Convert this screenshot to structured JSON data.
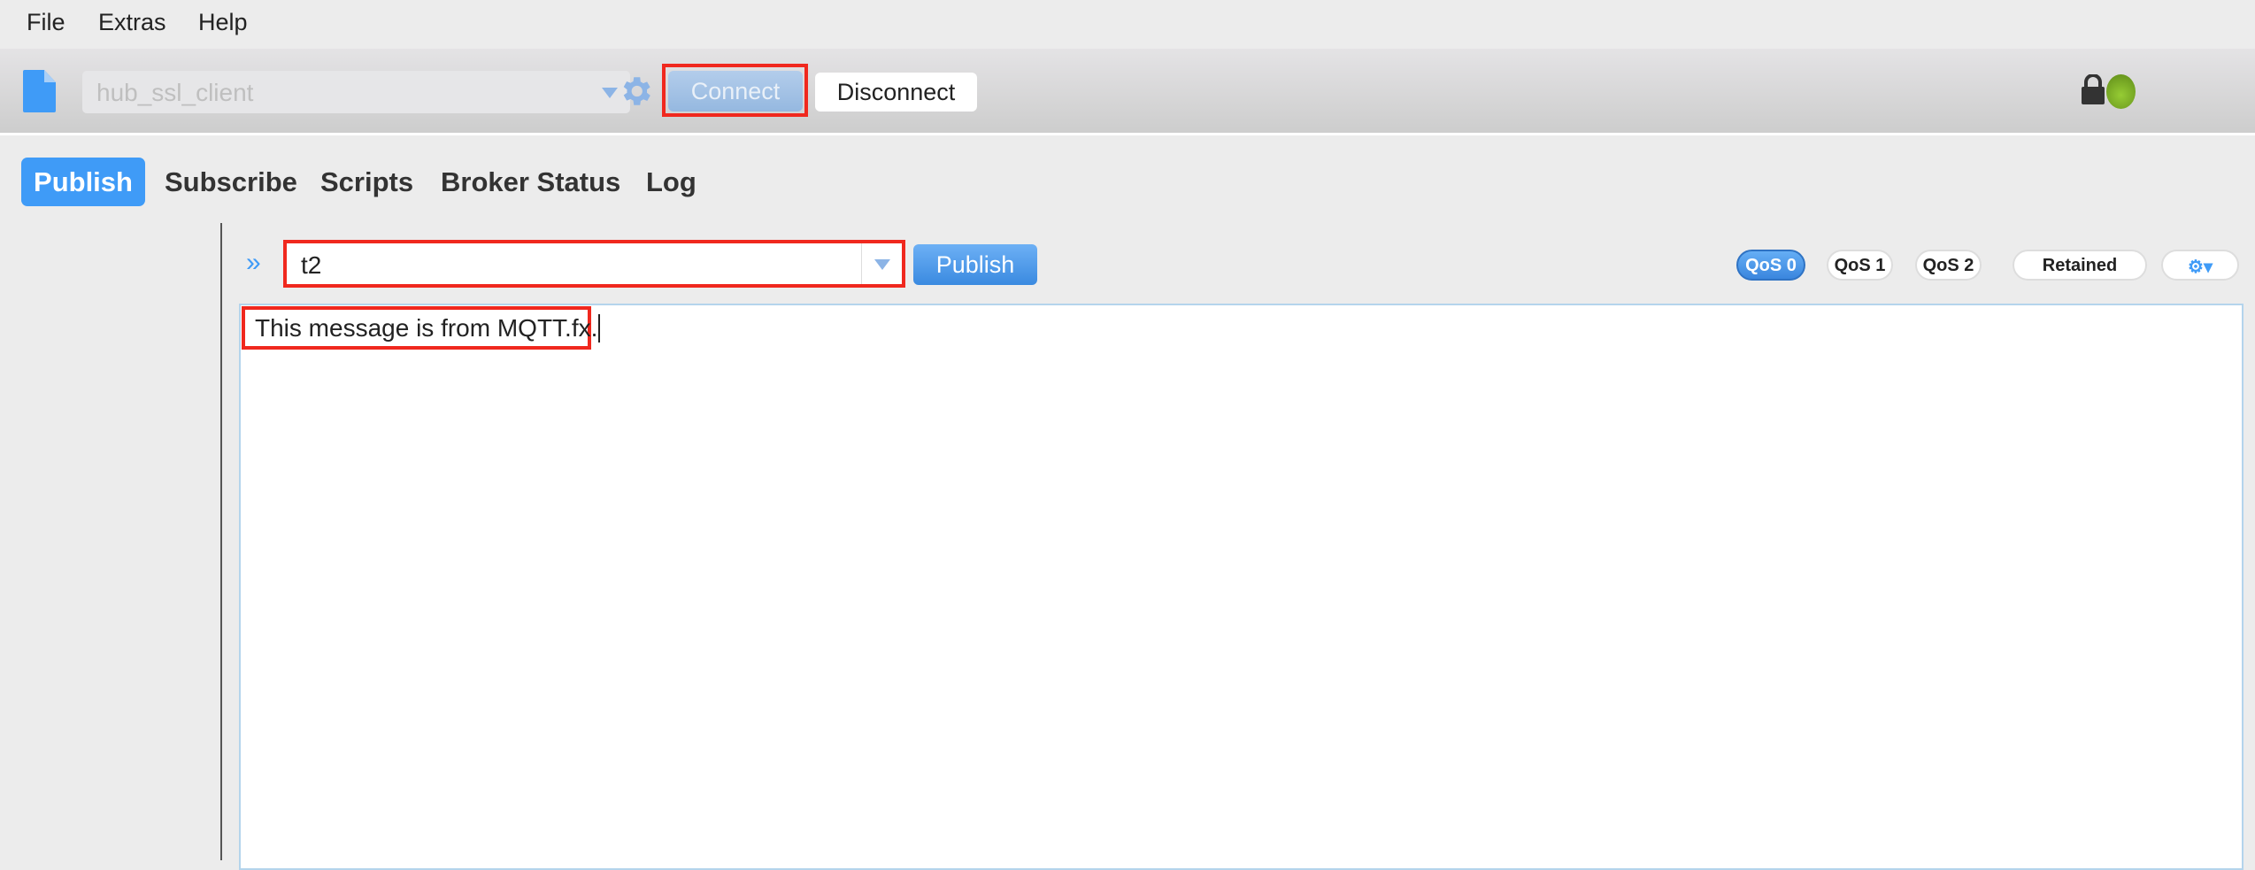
{
  "menu": [
    "File",
    "Extras",
    "Help"
  ],
  "toolbar": {
    "profile": "hub_ssl_client",
    "connect": "Connect",
    "disconnect": "Disconnect"
  },
  "tabs": [
    "Publish",
    "Subscribe",
    "Scripts",
    "Broker Status",
    "Log"
  ],
  "publish": {
    "topic": "t2",
    "publish_button": "Publish",
    "qos": [
      "QoS 0",
      "QoS 1",
      "QoS 2"
    ],
    "selected_qos": "QoS 0",
    "retained": "Retained",
    "message": "This message is from MQTT.fx."
  },
  "colors": {
    "accent": "#3f9bf7",
    "status": "#7ab82a",
    "highlight": "#f0281e"
  }
}
